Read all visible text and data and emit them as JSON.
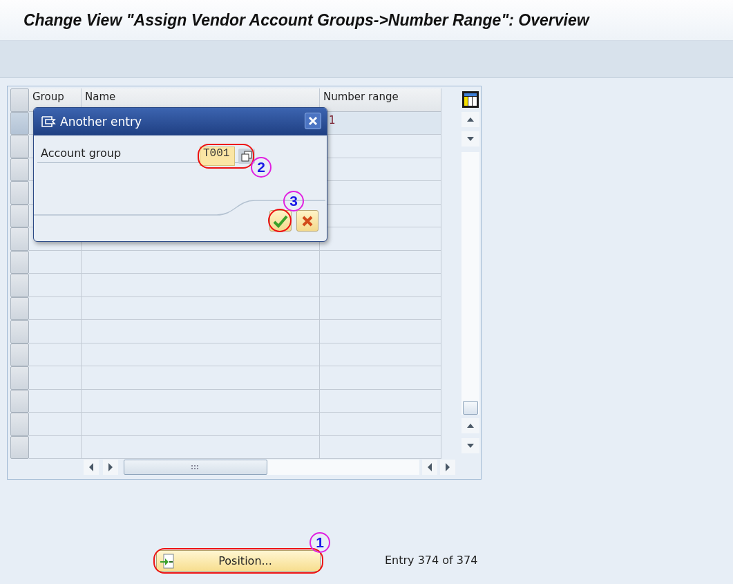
{
  "window": {
    "title": "Change View \"Assign Vendor Account Groups->Number Range\": Overview"
  },
  "table": {
    "columns": [
      "Group",
      "Name",
      "Number range"
    ],
    "rows": [
      {
        "number_range": "1",
        "selected": true
      },
      {
        "selected": false
      },
      {
        "selected": false
      },
      {
        "selected": false
      },
      {
        "selected": false
      },
      {
        "selected": false
      },
      {
        "selected": false
      },
      {
        "selected": false
      },
      {
        "selected": false
      },
      {
        "selected": false
      },
      {
        "selected": false
      },
      {
        "selected": false
      },
      {
        "selected": false
      },
      {
        "selected": false
      },
      {
        "selected": false
      }
    ]
  },
  "dialog": {
    "title": "Another entry",
    "field": {
      "label": "Account group",
      "value": "T001",
      "annotation": "2"
    },
    "confirm_annotation": "3"
  },
  "position_button": {
    "label": "Position...",
    "annotation": "1"
  },
  "entry_text": "Entry 374 of 374"
}
